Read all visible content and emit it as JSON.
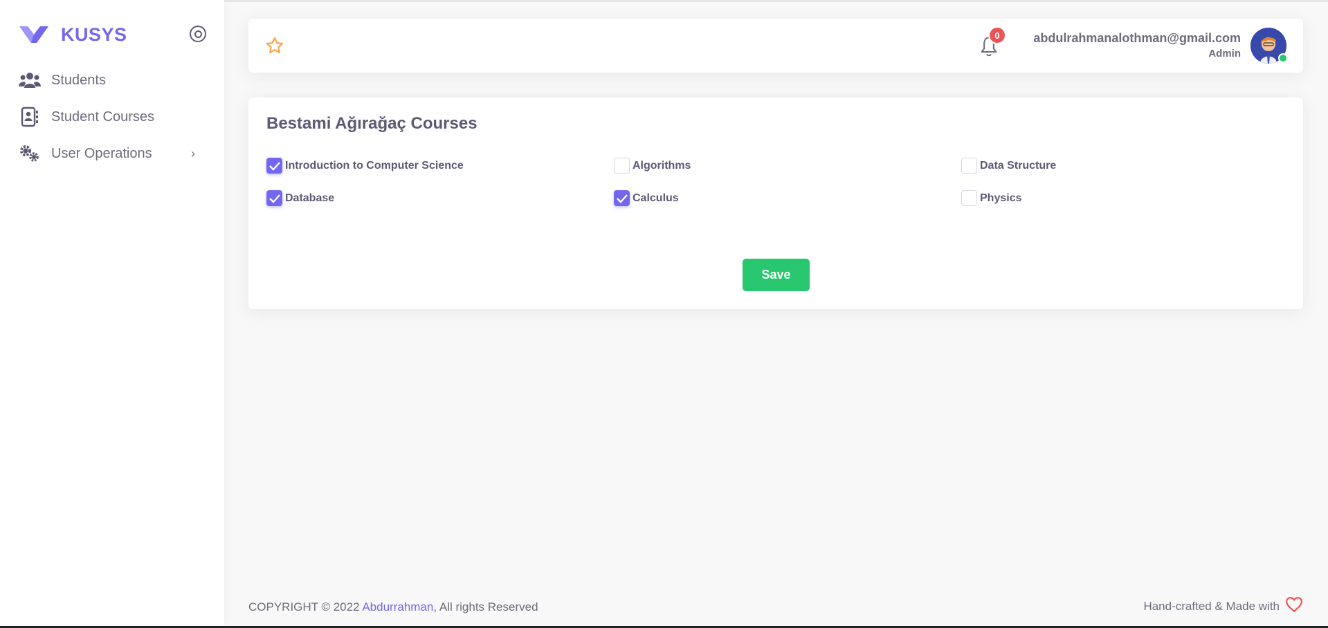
{
  "brand": {
    "name": "KUSYS",
    "accent_color": "#7367f0"
  },
  "sidebar": {
    "items": [
      {
        "label": "Students",
        "icon": "users-icon"
      },
      {
        "label": "Student Courses",
        "icon": "contact-book-icon"
      },
      {
        "label": "User Operations",
        "icon": "gears-icon",
        "has_submenu": true
      }
    ]
  },
  "topbar": {
    "notification_count": "0",
    "user_email": "abdulrahmanalothman@gmail.com",
    "user_role": "Admin"
  },
  "card": {
    "title": "Bestami Ağırağaç Courses",
    "courses": [
      {
        "label": "Introduction to Computer Science",
        "checked": true
      },
      {
        "label": "Algorithms",
        "checked": false
      },
      {
        "label": "Data Structure",
        "checked": false
      },
      {
        "label": "Database",
        "checked": true
      },
      {
        "label": "Calculus",
        "checked": true
      },
      {
        "label": "Physics",
        "checked": false
      }
    ],
    "save_label": "Save"
  },
  "footer": {
    "copyright_prefix": "COPYRIGHT © 2022 ",
    "author": "Abdurrahman",
    "copyright_suffix": ", All rights Reserved",
    "made_with": "Hand-crafted & Made with"
  },
  "colors": {
    "success": "#28c76f",
    "danger": "#ea5455",
    "star": "#ff9f43"
  }
}
